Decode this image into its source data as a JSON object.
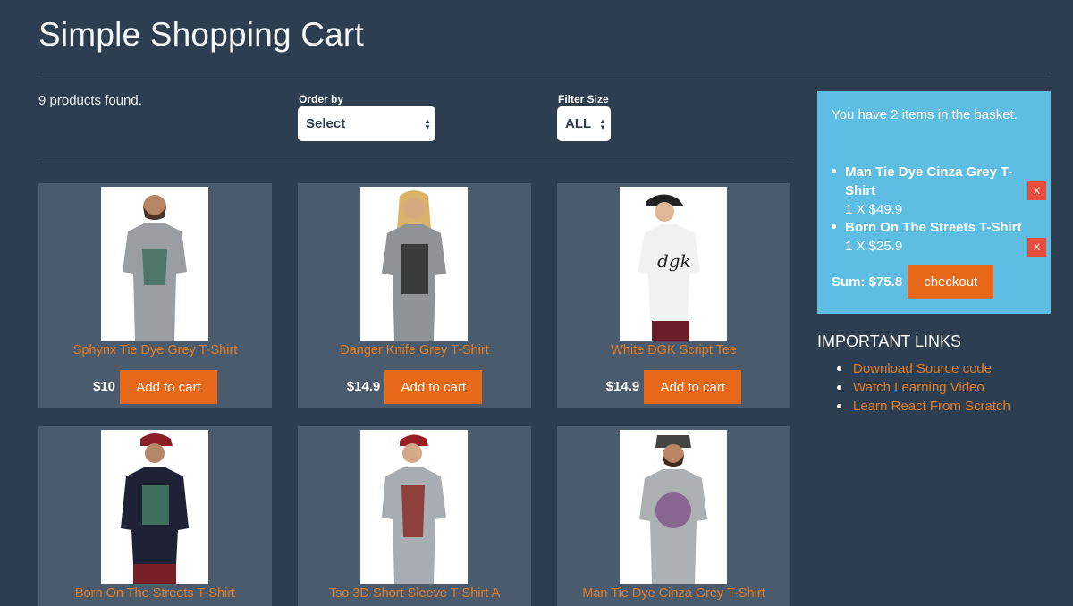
{
  "app": {
    "title": "Simple Shopping Cart"
  },
  "products_found": "9 products found.",
  "controls": {
    "order_label": "Order by",
    "order_value": "Select",
    "size_label": "Filter Size",
    "size_value": "ALL"
  },
  "products": [
    {
      "name": "Sphynx Tie Dye Grey T-Shirt",
      "price": "$10",
      "button": "Add to cart",
      "shirt_color": "#9a9ea3"
    },
    {
      "name": "Danger Knife Grey T-Shirt",
      "price": "$14.9",
      "button": "Add to cart",
      "shirt_color": "#8f9396"
    },
    {
      "name": "White DGK Script Tee",
      "price": "$14.9",
      "button": "Add to cart",
      "shirt_color": "#f1f1f1"
    },
    {
      "name": "Born On The Streets T-Shirt",
      "price": "",
      "button": "",
      "shirt_color": "#1f2236"
    },
    {
      "name": "Tso 3D Short Sleeve T-Shirt A",
      "price": "",
      "button": "",
      "shirt_color": "#a7adb3"
    },
    {
      "name": "Man Tie Dye Cinza Grey T-Shirt",
      "price": "",
      "button": "",
      "shirt_color": "#aeb1b4"
    }
  ],
  "basket": {
    "count_text": "You have 2 items in the basket.",
    "items": [
      {
        "name": "Man Tie Dye Cinza Grey T-Shirt",
        "qty": "1 X $49.9",
        "remove": "X"
      },
      {
        "name": "Born On The Streets T-Shirt",
        "qty": "1 X $25.9",
        "remove": "X"
      }
    ],
    "sum": "Sum: $75.8",
    "checkout": "checkout"
  },
  "links": {
    "title": "IMPORTANT LINKS",
    "items": [
      "Download Source code",
      "Watch Learning Video",
      "Learn React From Scratch"
    ]
  },
  "colors": {
    "background": "#2c3e50",
    "card": "#4a5b6e",
    "accent": "#e8681a",
    "basket": "#5dbde2",
    "remove": "#e74c3c",
    "link": "#e67e22"
  }
}
